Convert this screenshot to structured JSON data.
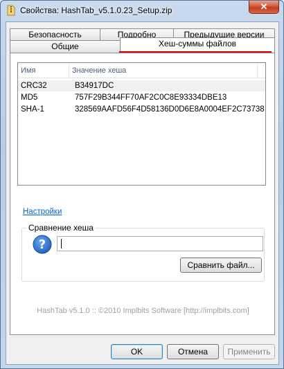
{
  "window": {
    "title": "Свойства: HashTab_v5.1.0.23_Setup.zip",
    "close_label": "✕"
  },
  "tabs": {
    "row1": [
      "Безопасность",
      "Подробно",
      "Предыдущие версии"
    ],
    "row2": [
      "Общие",
      "Хеш-суммы файлов"
    ],
    "active": "Хеш-суммы файлов"
  },
  "hash_list": {
    "columns": [
      "Имя",
      "Значение хеша"
    ],
    "rows": [
      {
        "name": "CRC32",
        "value": "B34917DC"
      },
      {
        "name": "MD5",
        "value": "757F29B344FF70AF2C0C8E93334DBE13"
      },
      {
        "name": "SHA-1",
        "value": "328569AAFD56F4D58136D0D6E8A0004EF2C73738"
      }
    ]
  },
  "settings_link": "Настройки",
  "compare": {
    "group_label": "Сравнение хеша",
    "input_value": "",
    "compare_button": "Сравнить файл..."
  },
  "footer": "HashTab v5.1.0 :: ©2010 Implbits Software [http://implbits.com]",
  "buttons": {
    "ok": "OK",
    "cancel": "Отмена",
    "apply": "Применить"
  },
  "colors": {
    "accent_underline": "#e00000",
    "link": "#0066cc",
    "help_icon": "#1f5fb8"
  },
  "icons": {
    "title": "zip-archive-icon",
    "help": "question-mark-icon"
  }
}
